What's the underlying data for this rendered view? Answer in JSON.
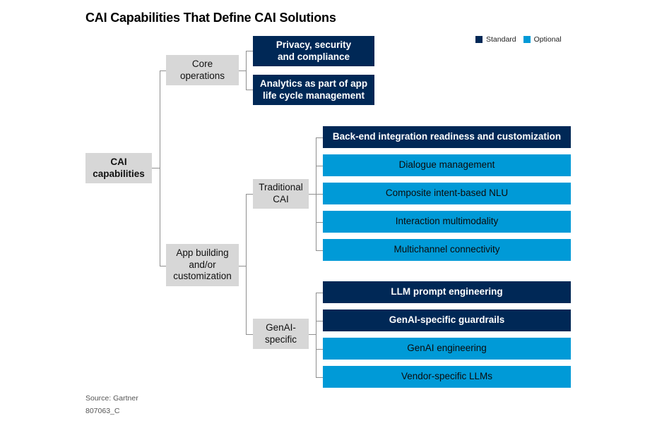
{
  "title": "CAI Capabilities That Define CAI Solutions",
  "legend": [
    {
      "label": "Standard",
      "color": "#002856"
    },
    {
      "label": "Optional",
      "color": "#009ad7"
    }
  ],
  "colors": {
    "standard": "#002856",
    "optional": "#009ad7",
    "category": "#d7d7d7",
    "connector": "#8f8f8f"
  },
  "root": {
    "label_line1": "CAI",
    "label_line2": "capabilities"
  },
  "core_operations": {
    "label_line1": "Core",
    "label_line2": "operations",
    "items": [
      {
        "line1": "Privacy, security",
        "line2": "and compliance",
        "type": "Standard"
      },
      {
        "line1": "Analytics as part of app",
        "line2": "life cycle management",
        "type": "Standard"
      }
    ]
  },
  "app_building": {
    "label_line1": "App building",
    "label_line2": "and/or",
    "label_line3": "customization",
    "traditional": {
      "label_line1": "Traditional",
      "label_line2": "CAI",
      "items": [
        {
          "label": "Back-end integration readiness and customization",
          "type": "Standard"
        },
        {
          "label": "Dialogue management",
          "type": "Optional"
        },
        {
          "label": "Composite intent-based NLU",
          "type": "Optional"
        },
        {
          "label": "Interaction multimodality",
          "type": "Optional"
        },
        {
          "label": "Multichannel connectivity",
          "type": "Optional"
        }
      ]
    },
    "genai": {
      "label_line1": "GenAI-",
      "label_line2": "specific",
      "items": [
        {
          "label": "LLM prompt engineering",
          "type": "Standard"
        },
        {
          "label": "GenAI-specific guardrails",
          "type": "Standard"
        },
        {
          "label": "GenAI engineering",
          "type": "Optional"
        },
        {
          "label": "Vendor-specific LLMs",
          "type": "Optional"
        }
      ]
    }
  },
  "footer": {
    "source": "Source: Gartner",
    "id": "807063_C"
  }
}
